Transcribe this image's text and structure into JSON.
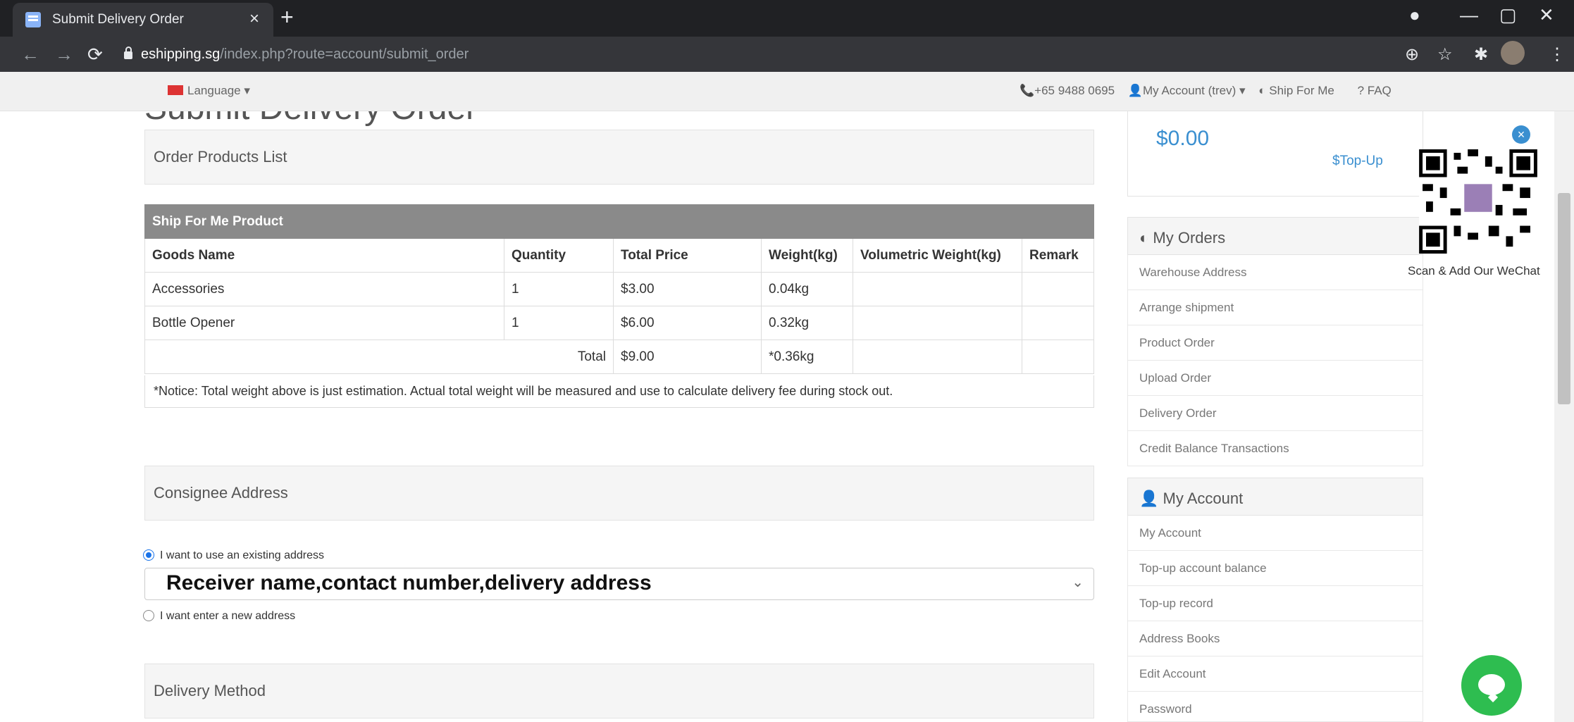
{
  "browser": {
    "tab_title": "Submit Delivery Order",
    "tab_close": "×",
    "new_tab": "+",
    "url_host": "eshipping.sg",
    "url_path": "/index.php?route=account/submit_order"
  },
  "sitebar": {
    "language": "Language ▾",
    "phone": "📞+65 9488 0695",
    "account": "👤My Account (trev) ▾",
    "ship_for_me": "Ship For Me",
    "faq": "? FAQ"
  },
  "page": {
    "heading_partial": "Submit Delivery Order",
    "order_products_list": "Order Products List",
    "table": {
      "caption": "Ship For Me Product",
      "headers": [
        "Goods Name",
        "Quantity",
        "Total Price",
        "Weight(kg)",
        "Volumetric Weight(kg)",
        "Remark"
      ],
      "rows": [
        [
          "Accessories",
          "1",
          "$3.00",
          "0.04kg",
          "",
          ""
        ],
        [
          "Bottle Opener",
          "1",
          "$6.00",
          "0.32kg",
          "",
          ""
        ]
      ],
      "total_label": "Total",
      "total_price": "$9.00",
      "total_weight": "*0.36kg"
    },
    "notice": "*Notice: Total weight above is just estimation. Actual total weight will be measured and use to calculate delivery fee during stock out.",
    "consignee_address": "Consignee Address",
    "radio_existing": "I want to use an existing address",
    "select_value": "Receiver name,contact number,delivery address",
    "radio_new": "I want enter a new address",
    "delivery_method": "Delivery Method"
  },
  "sidebar": {
    "balance": "$0.00",
    "topup": "$Top-Up",
    "my_orders_head": "My Orders",
    "orders": [
      "Warehouse Address",
      "Arrange shipment",
      "Product Order",
      "Upload Order",
      "Delivery Order",
      "Credit Balance Transactions"
    ],
    "my_account_head": "My Account",
    "account": [
      "My Account",
      "Top-up account balance",
      "Top-up record",
      "Address Books",
      "Edit Account",
      "Password"
    ]
  },
  "qr": {
    "caption": "Scan & Add Our WeChat",
    "close": "×"
  }
}
